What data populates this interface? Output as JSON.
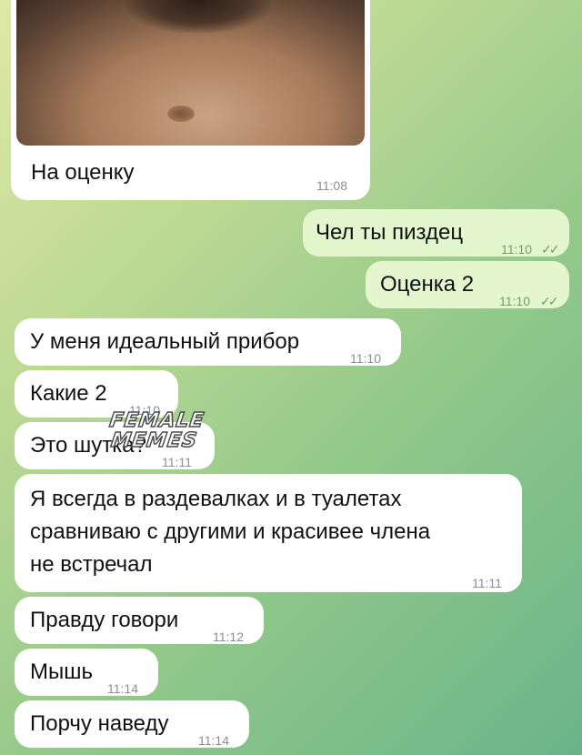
{
  "messages": [
    {
      "text": "На оценку",
      "time": "11:08",
      "dir": "in"
    },
    {
      "text": "Чел ты пиздец",
      "time": "11:10",
      "dir": "out"
    },
    {
      "text": "Оценка 2",
      "time": "11:10",
      "dir": "out"
    },
    {
      "text": "У меня идеальный прибор",
      "time": "11:10",
      "dir": "in"
    },
    {
      "text": "Какие 2",
      "time": "11:10",
      "dir": "in"
    },
    {
      "text": "Это шутка?",
      "time": "11:11",
      "dir": "in"
    },
    {
      "line1": "Я всегда в раздевалках и в туалетах",
      "line2": "сравниваю с другими и красивее члена",
      "line3": "не встречал",
      "time": "11:11",
      "dir": "in"
    },
    {
      "text": "Правду говори",
      "time": "11:12",
      "dir": "in"
    },
    {
      "text": "Мышь",
      "time": "11:14",
      "dir": "in"
    },
    {
      "text": "Порчу наведу",
      "time": "11:14",
      "dir": "in"
    }
  ],
  "watermark": {
    "line1": "FEMALE",
    "line2": "MEMES"
  },
  "ticks": "✓✓"
}
